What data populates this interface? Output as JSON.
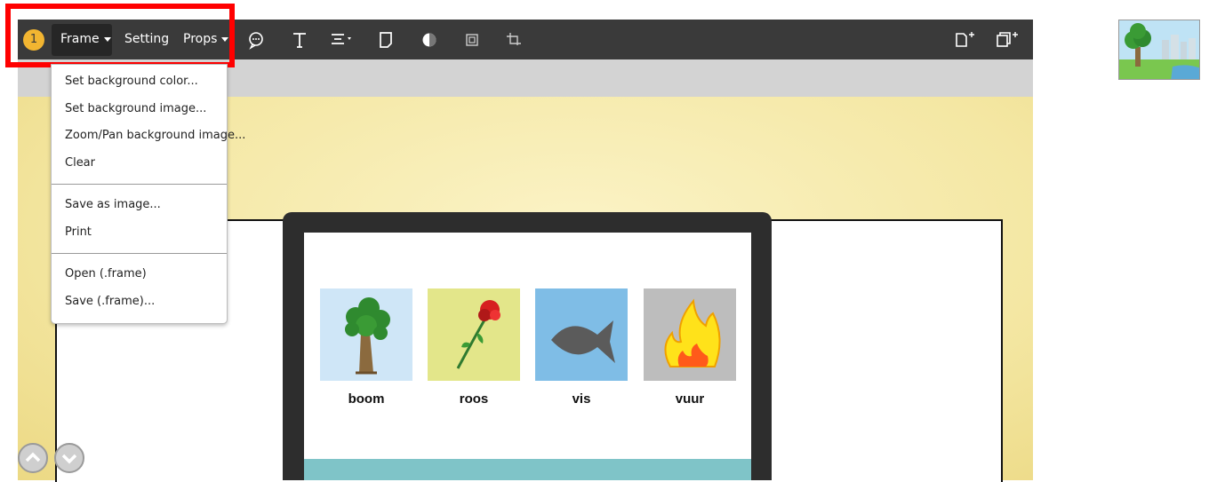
{
  "toolbar": {
    "page_number": "1",
    "frame_label": "Frame",
    "setting_label": "Setting",
    "props_label": "Props",
    "icons": [
      "speech-bubble-icon",
      "text-icon",
      "align-icon",
      "frame-shape-icon",
      "contrast-icon",
      "fit-icon",
      "crop-icon",
      "add-page-icon",
      "duplicate-page-icon"
    ]
  },
  "frame_menu": {
    "items_group1": [
      "Set background color...",
      "Set background image...",
      "Zoom/Pan background image...",
      "Clear"
    ],
    "items_group2": [
      "Save as image...",
      "Print"
    ],
    "items_group3": [
      "Open (.frame)",
      "Save (.frame)..."
    ]
  },
  "cards": [
    {
      "label": "boom",
      "bg": "#cfe6f7"
    },
    {
      "label": "roos",
      "bg": "#e3e68a"
    },
    {
      "label": "vis",
      "bg": "#7fbde6"
    },
    {
      "label": "vuur",
      "bg": "#bdbdbd"
    }
  ],
  "colors": {
    "toolbar": "#3a3a3a",
    "accent": "#f2b531",
    "highlight": "#ff0000"
  }
}
